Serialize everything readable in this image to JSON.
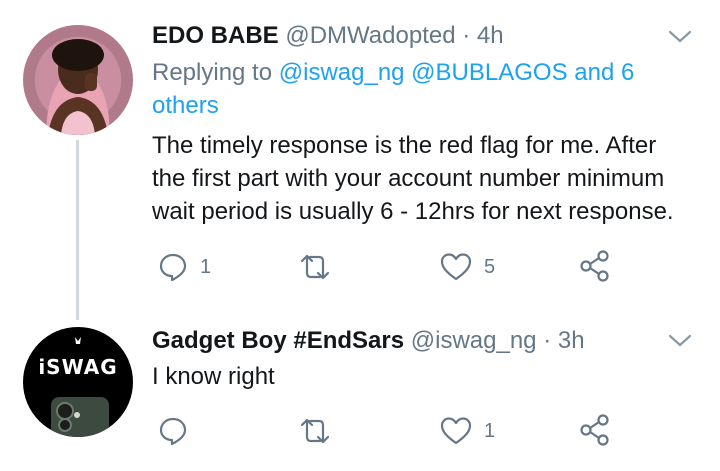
{
  "tweets": [
    {
      "display_name": "EDO BABE",
      "handle": "@DMWadopted",
      "dot": "·",
      "time": "4h",
      "replying_prefix": "Replying to",
      "replying_mentions": "@iswag_ng @BUBLAGOS and 6",
      "replying_others": "others",
      "text_lines": [
        "The timely response is the red flag for me. After",
        "the first part with your account number minimum",
        "wait period is usually 6 - 12hrs for next response."
      ],
      "reply_count": "1",
      "retweet_count": "",
      "like_count": "5",
      "avatar_icon": "profile-photo"
    },
    {
      "display_name": "Gadget Boy #EndSars",
      "handle": "@iswag_ng",
      "dot": "·",
      "time": "3h",
      "text_lines": [
        "I know right"
      ],
      "reply_count": "",
      "retweet_count": "",
      "like_count": "1",
      "avatar_logo_text": "iSWAG"
    }
  ],
  "colors": {
    "text": "#14171a",
    "secondary": "#657786",
    "link": "#1da1f2",
    "thread_line": "#cfd9de"
  },
  "icons": [
    "reply-icon",
    "retweet-icon",
    "like-icon",
    "share-icon",
    "chevron-down-icon"
  ]
}
